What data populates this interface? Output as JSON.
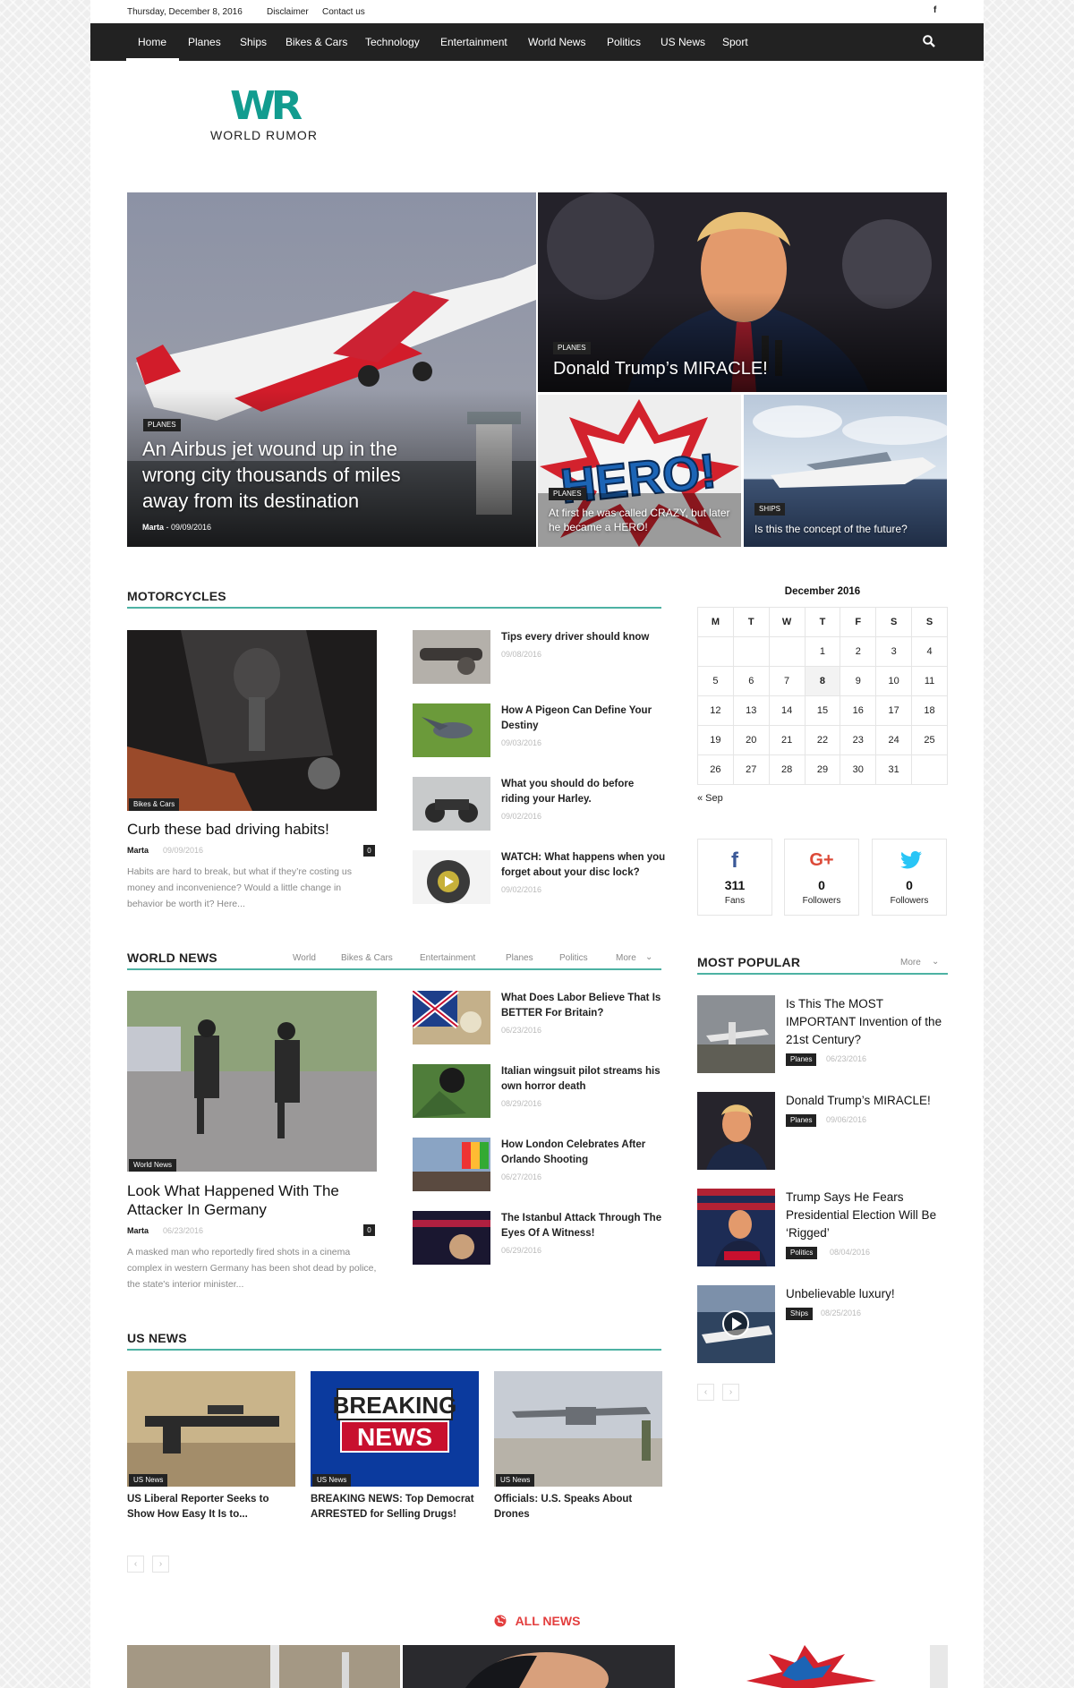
{
  "topbar": {
    "date": "Thursday, December 8, 2016",
    "disclaimer": "Disclaimer",
    "contact": "Contact us",
    "facebook_icon": "f"
  },
  "menu": [
    "Home",
    "Planes",
    "Ships",
    "Bikes & Cars",
    "Technology",
    "Entertainment",
    "World News",
    "Politics",
    "US News",
    "Sport"
  ],
  "logo": {
    "mark": "WR",
    "text": "WORLD RUMOR"
  },
  "featured": {
    "main": {
      "tag": "PLANES",
      "title": "An Airbus jet wound up in the wrong city thousands of miles away from its destination",
      "author": "Marta",
      "date": "09/09/2016"
    },
    "top_right": {
      "tag": "PLANES",
      "title": "Donald Trump’s MIRACLE!"
    },
    "bottom_left": {
      "tag": "PLANES",
      "title": "At first he was called CRAZY, but later he became a HERO!",
      "image_text": "HERO!"
    },
    "bottom_right": {
      "tag": "SHIPS",
      "title": "Is this the concept of the future?"
    }
  },
  "motorcycles": {
    "heading": "MOTORCYCLES",
    "main": {
      "tag": "Bikes & Cars",
      "title": "Curb these bad driving habits!",
      "author": "Marta",
      "date": "09/09/2016",
      "comments": "0",
      "excerpt": "Habits are hard to break, but what if they’re costing us money and inconvenience? Would a little change in behavior be worth it? Here..."
    },
    "list": [
      {
        "title": "Tips every driver should know",
        "date": "09/08/2016"
      },
      {
        "title": "How A Pigeon Can Define Your Destiny",
        "date": "09/03/2016"
      },
      {
        "title": "What you should do before riding your Harley.",
        "date": "09/02/2016"
      },
      {
        "title": "WATCH: What happens when you forget about your disc lock?",
        "date": "09/02/2016"
      }
    ]
  },
  "world_news": {
    "heading": "WORLD NEWS",
    "tabs": [
      "World",
      "Bikes & Cars",
      "Entertainment",
      "Planes",
      "Politics",
      "More"
    ],
    "main": {
      "tag": "World News",
      "title": "Look What Happened With The Attacker In Germany",
      "author": "Marta",
      "date": "06/23/2016",
      "comments": "0",
      "excerpt": "A masked man who reportedly fired shots in a cinema complex in western Germany has been shot dead by police, the state's interior minister..."
    },
    "list": [
      {
        "title": "What Does Labor Believe That Is BETTER For Britain?",
        "date": "06/23/2016"
      },
      {
        "title": "Italian wingsuit pilot streams his own horror death",
        "date": "08/29/2016"
      },
      {
        "title": "How London Celebrates After Orlando Shooting",
        "date": "06/27/2016"
      },
      {
        "title": "The Istanbul Attack Through The Eyes Of A Witness!",
        "date": "06/29/2016"
      }
    ]
  },
  "us_news": {
    "heading": "US NEWS",
    "items": [
      {
        "tag": "US News",
        "title": "US Liberal Reporter Seeks to Show How Easy It Is to..."
      },
      {
        "tag": "US News",
        "title": "BREAKING NEWS: Top Democrat ARRESTED for Selling Drugs!",
        "image_text_1": "BREAKING",
        "image_text_2": "NEWS"
      },
      {
        "tag": "US News",
        "title": "Officials: U.S. Speaks About Drones"
      }
    ]
  },
  "calendar": {
    "title": "December 2016",
    "days": [
      "M",
      "T",
      "W",
      "T",
      "F",
      "S",
      "S"
    ],
    "weeks": [
      [
        "",
        "",
        "",
        "1",
        "2",
        "3",
        "4"
      ],
      [
        "5",
        "6",
        "7",
        "8",
        "9",
        "10",
        "11"
      ],
      [
        "12",
        "13",
        "14",
        "15",
        "16",
        "17",
        "18"
      ],
      [
        "19",
        "20",
        "21",
        "22",
        "23",
        "24",
        "25"
      ],
      [
        "26",
        "27",
        "28",
        "29",
        "30",
        "31",
        ""
      ]
    ],
    "prev": "« Sep"
  },
  "social": [
    {
      "icon": "f",
      "count": "311",
      "label": "Fans",
      "color": "#3b5998"
    },
    {
      "icon": "G+",
      "count": "0",
      "label": "Followers",
      "color": "#dc4a38"
    },
    {
      "icon": "twitter-bird",
      "count": "0",
      "label": "Followers",
      "color": "#29c5f6"
    }
  ],
  "most_popular": {
    "heading": "MOST POPULAR",
    "more": "More",
    "items": [
      {
        "title": "Is This The MOST IMPORTANT Invention of the 21st Century?",
        "tag": "Planes",
        "date": "06/23/2016"
      },
      {
        "title": "Donald Trump’s MIRACLE!",
        "tag": "Planes",
        "date": "09/06/2016"
      },
      {
        "title": "Trump Says He Fears Presidential Election Will Be ‘Rigged’",
        "tag": "Politics",
        "date": "08/04/2016"
      },
      {
        "title": "Unbelievable luxury!",
        "tag": "Ships",
        "date": "08/25/2016"
      }
    ]
  },
  "all_news": "ALL NEWS",
  "colors": {
    "accent": "#4db2a3",
    "red": "#e33e3e",
    "logo": "#129c8f"
  }
}
